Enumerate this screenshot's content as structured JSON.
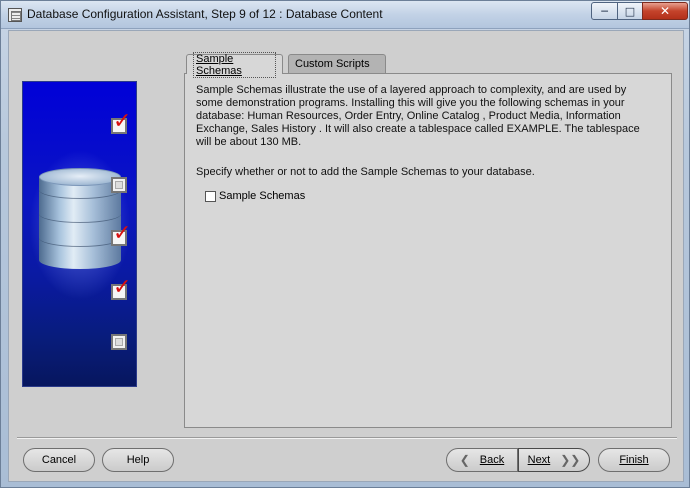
{
  "window": {
    "title": "Database Configuration Assistant, Step 9 of 12 : Database Content",
    "controls": {
      "minimize": "─",
      "maximize": "□",
      "close": "✕"
    }
  },
  "left_panel": {
    "steps": [
      {
        "checked": true
      },
      {
        "checked": false
      },
      {
        "checked": true
      },
      {
        "checked": true
      },
      {
        "checked": false
      }
    ],
    "check_mark": "✓"
  },
  "tabs": [
    {
      "label": "Sample Schemas",
      "active": true
    },
    {
      "label": "Custom Scripts",
      "active": false
    }
  ],
  "content": {
    "description": "Sample Schemas illustrate the use of a layered approach to complexity, and are used by some demonstration programs. Installing this will give you the following schemas in your database: Human Resources, Order Entry, Online Catalog , Product Media, Information Exchange, Sales History . It will also create a tablespace called EXAMPLE. The tablespace will be about 130 MB.",
    "prompt": "Specify whether or not to add the Sample Schemas to your database.",
    "checkbox_label": "Sample Schemas",
    "checkbox_checked": false
  },
  "buttons": {
    "cancel": "Cancel",
    "help": "Help",
    "back": "Back",
    "next": "Next",
    "finish": "Finish",
    "back_arrow": "❮",
    "next_arrow": "❯❯"
  }
}
